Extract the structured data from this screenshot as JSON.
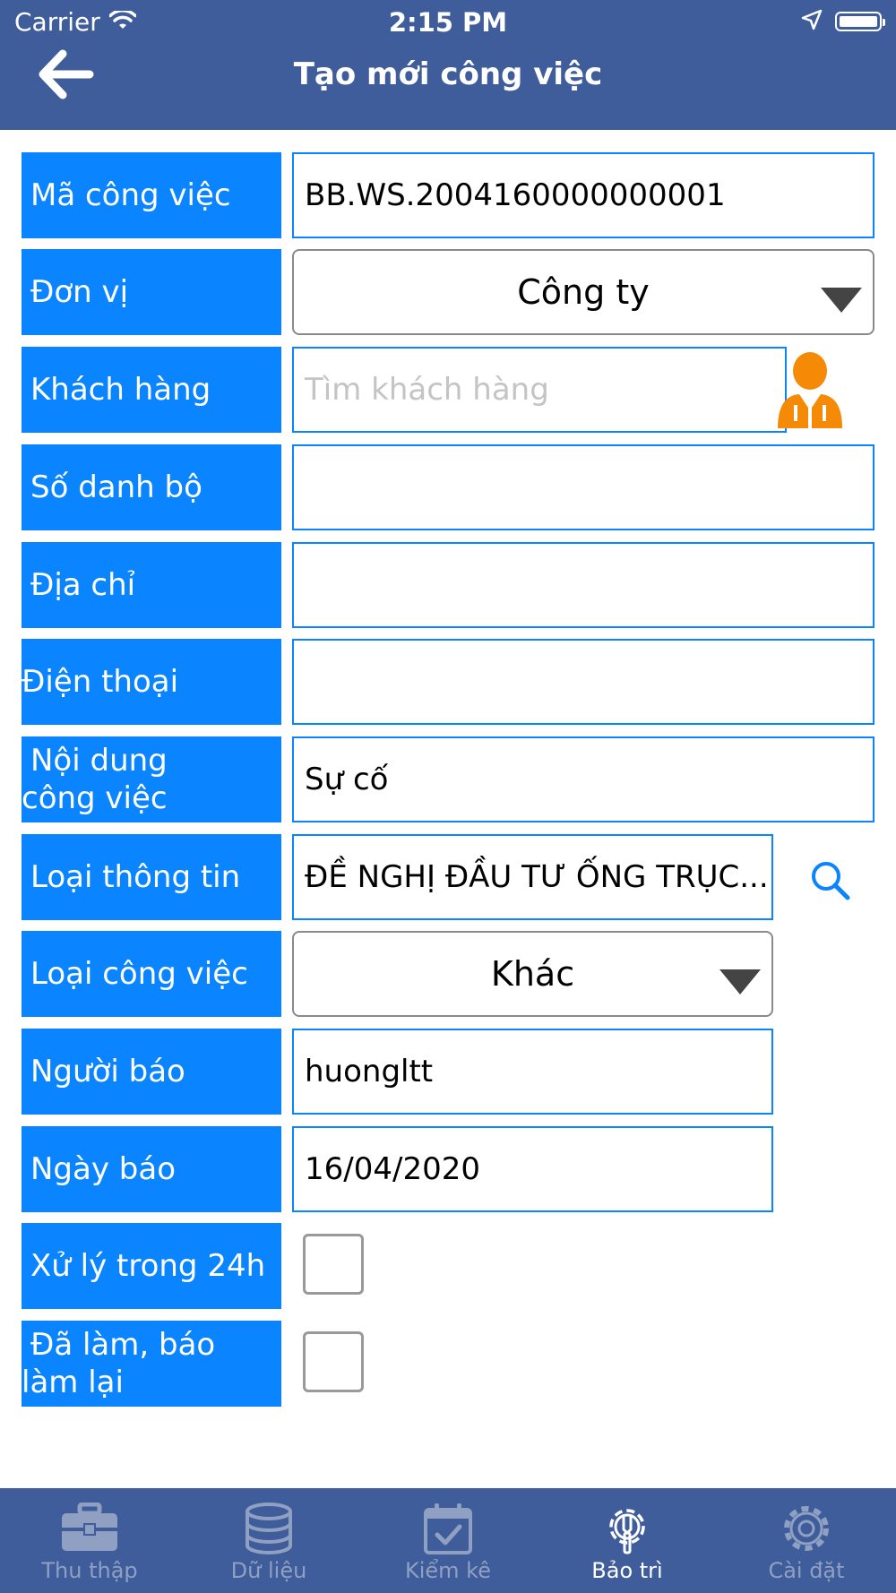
{
  "status_bar": {
    "carrier": "Carrier",
    "time": "2:15 PM"
  },
  "header": {
    "title": "Tạo mới công việc"
  },
  "form": {
    "ma_cong_viec": {
      "label": "Mã công việc",
      "value": "BB.WS.2004160000000001"
    },
    "don_vi": {
      "label": "Đơn vị",
      "value": "Công ty"
    },
    "khach_hang": {
      "label": "Khách hàng",
      "value": "",
      "placeholder": "Tìm khách hàng"
    },
    "so_danh_bo": {
      "label": "Số danh bộ",
      "value": ""
    },
    "dia_chi": {
      "label": "Địa chỉ",
      "value": ""
    },
    "dien_thoai": {
      "label": "Điện thoại",
      "value": ""
    },
    "noi_dung": {
      "label_line1": "Nội dung",
      "label_line2": "công việc",
      "value": "Sự cố"
    },
    "loai_thong_tin": {
      "label": "Loại thông tin",
      "value": "ĐỀ NGHỊ ĐẦU TƯ ỐNG TRỤC..."
    },
    "loai_cong_viec": {
      "label": "Loại công việc",
      "value": "Khác"
    },
    "nguoi_bao": {
      "label": "Người báo",
      "value": "huongltt"
    },
    "ngay_bao": {
      "label": "Ngày báo",
      "value": "16/04/2020"
    },
    "xu_ly_24h": {
      "label": "Xử lý trong 24h",
      "checked": false
    },
    "da_lam": {
      "label_line1": "Đã làm, báo",
      "label_line2": "làm lại",
      "checked": false
    }
  },
  "tabbar": {
    "tabs": [
      {
        "label": "Thu thập",
        "icon": "toolbox-icon"
      },
      {
        "label": "Dữ liệu",
        "icon": "database-icon"
      },
      {
        "label": "Kiểm kê",
        "icon": "calendar-check-icon"
      },
      {
        "label": "Bảo trì",
        "icon": "gear-wrench-icon",
        "active": true
      },
      {
        "label": "Cài đặt",
        "icon": "gear-icon"
      }
    ]
  },
  "colors": {
    "header_bg": "#3f5d9a",
    "label_bg": "#0a84ff",
    "field_border": "#0a84ff",
    "person_icon": "#f58a07",
    "tab_inactive": "#8fa0c2"
  }
}
